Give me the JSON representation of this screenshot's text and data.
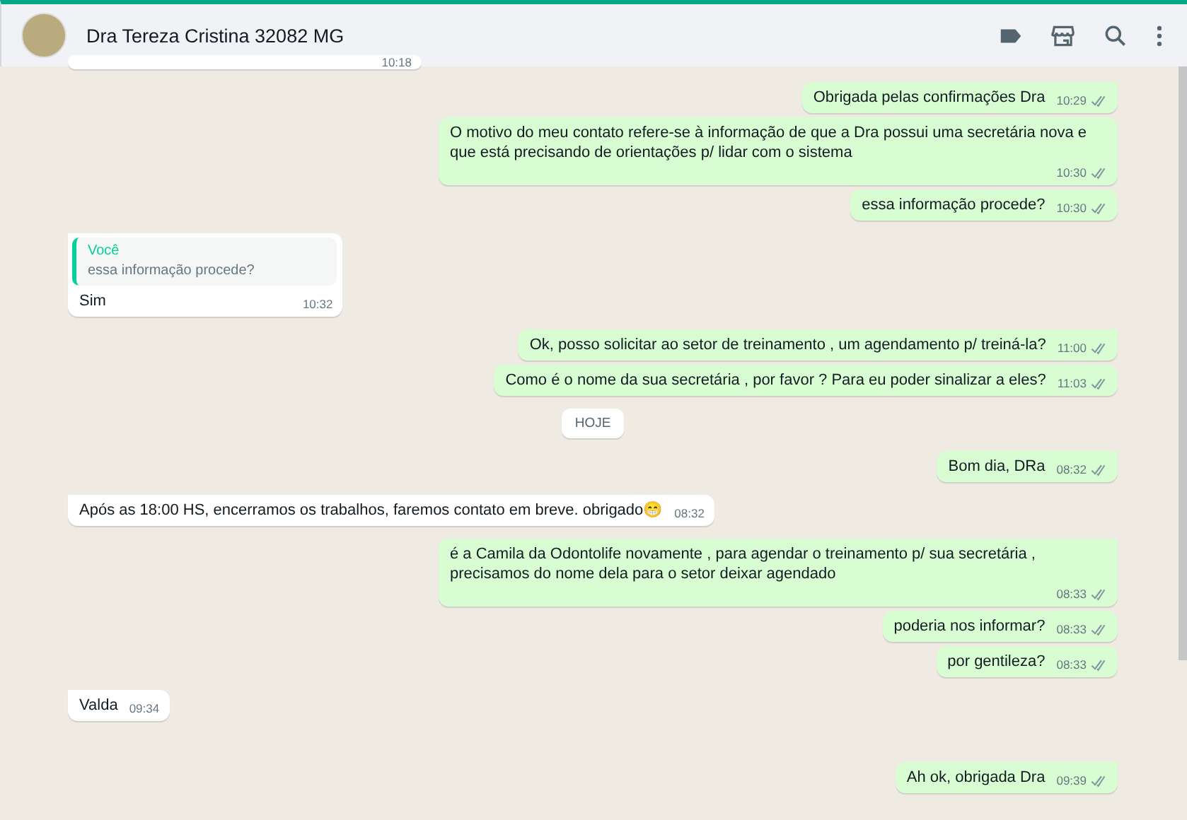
{
  "header": {
    "title": "Dra Tereza Cristina 32082 MG"
  },
  "messages": [
    {
      "kind": "in",
      "tail": false,
      "time": "10:18"
    },
    {
      "kind": "out",
      "tail": true,
      "text": "Obrigada pelas confirmações Dra",
      "time": "10:29"
    },
    {
      "kind": "out",
      "tail": false,
      "text": "O motivo do meu contato refere-se à informação de que a Dra possui uma secretária nova e que está precisando de orientações p/ lidar com o sistema",
      "time": "10:30"
    },
    {
      "kind": "out",
      "tail": false,
      "text": "essa informação procede?",
      "time": "10:30"
    },
    {
      "kind": "in",
      "tail": true,
      "quote": {
        "author": "Você",
        "text": "essa informação procede?"
      },
      "text": "Sim",
      "time": "10:32"
    },
    {
      "kind": "out",
      "tail": true,
      "text": "Ok, posso solicitar ao setor de treinamento , um agendamento p/ treiná-la?",
      "time": "11:00"
    },
    {
      "kind": "out",
      "tail": false,
      "text": "Como é o nome da sua secretária , por favor ? Para eu poder sinalizar a eles?",
      "time": "11:03"
    },
    {
      "kind": "date",
      "text": "HOJE"
    },
    {
      "kind": "out",
      "tail": true,
      "text": "Bom dia, DRa",
      "time": "08:32"
    },
    {
      "kind": "in",
      "tail": true,
      "text": "Após as 18:00 HS, encerramos os trabalhos, faremos contato em breve. obrigado😁",
      "time": "08:32"
    },
    {
      "kind": "out",
      "tail": true,
      "text": "é a Camila da Odontolife novamente , para agendar o treinamento p/ sua secretária , precisamos do nome dela para o setor deixar agendado",
      "time": "08:33"
    },
    {
      "kind": "out",
      "tail": false,
      "text": "poderia nos informar?",
      "time": "08:33"
    },
    {
      "kind": "out",
      "tail": false,
      "text": "por gentileza?",
      "time": "08:33"
    },
    {
      "kind": "in",
      "tail": true,
      "text": "Valda",
      "time": "09:34"
    },
    {
      "kind": "out",
      "tail": true,
      "text": "Ah ok, obrigada Dra",
      "time": "09:39"
    }
  ]
}
